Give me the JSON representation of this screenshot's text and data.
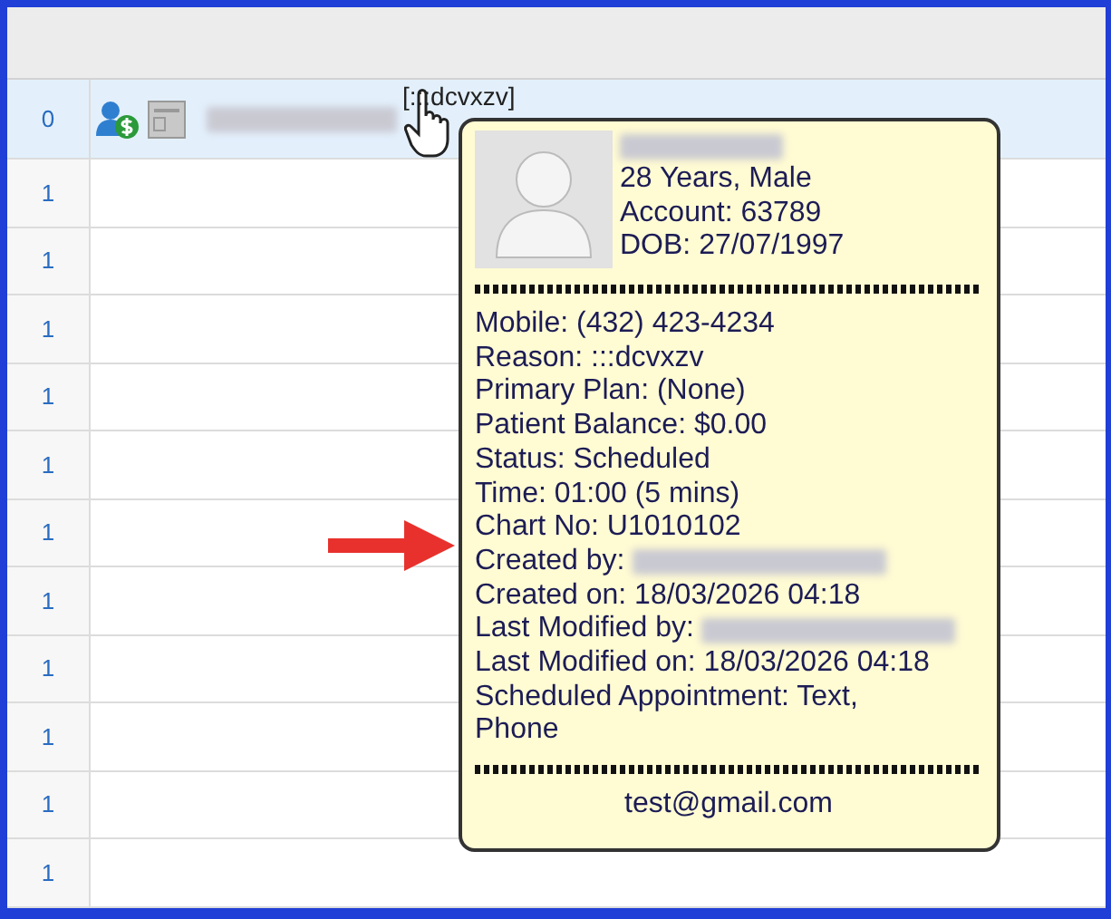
{
  "grid": {
    "rows": [
      {
        "index": "0",
        "selected": true,
        "name_redacted": true,
        "reason": "[:::dcvxzv]"
      },
      {
        "index": "1",
        "selected": false
      },
      {
        "index": "1",
        "selected": false
      },
      {
        "index": "1",
        "selected": false
      },
      {
        "index": "1",
        "selected": false
      },
      {
        "index": "1",
        "selected": false
      },
      {
        "index": "1",
        "selected": false
      },
      {
        "index": "1",
        "selected": false
      },
      {
        "index": "1",
        "selected": false
      },
      {
        "index": "1",
        "selected": false
      },
      {
        "index": "1",
        "selected": false
      },
      {
        "index": "1",
        "selected": false
      }
    ]
  },
  "tooltip": {
    "name_redacted": true,
    "summary": [
      "28 Years, Male",
      "Account: 63789",
      "DOB: 27/07/1997"
    ],
    "details": [
      {
        "kind": "text",
        "text": "Mobile: (432) 423-4234"
      },
      {
        "kind": "text",
        "text": "Reason: :::dcvxzv"
      },
      {
        "kind": "text",
        "text": "Primary Plan: (None)"
      },
      {
        "kind": "text",
        "text": "Patient Balance: $0.00"
      },
      {
        "kind": "text",
        "text": "Status: Scheduled"
      },
      {
        "kind": "text",
        "text": "Time: 01:00 (5 mins)"
      },
      {
        "kind": "text",
        "text": "Chart No: U1010102"
      },
      {
        "kind": "redacted",
        "text": "Created by:"
      },
      {
        "kind": "text",
        "text": "Created on: 18/03/2026 04:18"
      },
      {
        "kind": "redacted",
        "text": "Last Modified by:"
      },
      {
        "kind": "text",
        "text": "Last Modified on: 18/03/2026 04:18"
      },
      {
        "kind": "text",
        "text": "Scheduled Appointment: Text, Phone"
      }
    ],
    "email": "test@gmail.com"
  }
}
